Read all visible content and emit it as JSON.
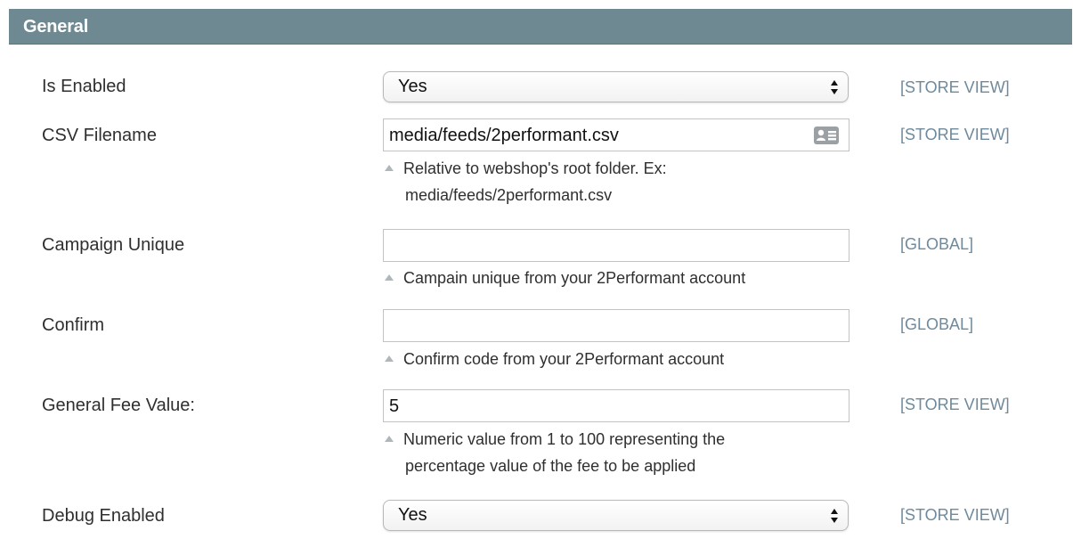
{
  "section": {
    "title": "General"
  },
  "fields": {
    "is_enabled": {
      "label": "Is Enabled",
      "value": "Yes",
      "scope": "[STORE VIEW]"
    },
    "csv_filename": {
      "label": "CSV Filename",
      "value": "media/feeds/2performant.csv",
      "scope": "[STORE VIEW]",
      "note_line1": "Relative to webshop's root folder. Ex:",
      "note_line2": "media/feeds/2performant.csv"
    },
    "campaign_unique": {
      "label": "Campaign Unique",
      "value": "",
      "scope": "[GLOBAL]",
      "note_line1": "Campain unique from your 2Performant account"
    },
    "confirm": {
      "label": "Confirm",
      "value": "",
      "scope": "[GLOBAL]",
      "note_line1": "Confirm code from your 2Performant account"
    },
    "general_fee_value": {
      "label": "General Fee Value:",
      "value": "5",
      "scope": "[STORE VIEW]",
      "note_line1": "Numeric value from 1 to 100 representing the",
      "note_line2": "percentage value of the fee to be applied"
    },
    "debug_enabled": {
      "label": "Debug Enabled",
      "value": "Yes",
      "scope": "[STORE VIEW]"
    }
  },
  "icons": {
    "select_arrows": "up-down-chevron-icon",
    "autofill": "contact-card-icon",
    "note": "triangle-up-icon"
  },
  "colors": {
    "header_bg": "#6f8992",
    "scope_text": "#6e8a9c"
  }
}
